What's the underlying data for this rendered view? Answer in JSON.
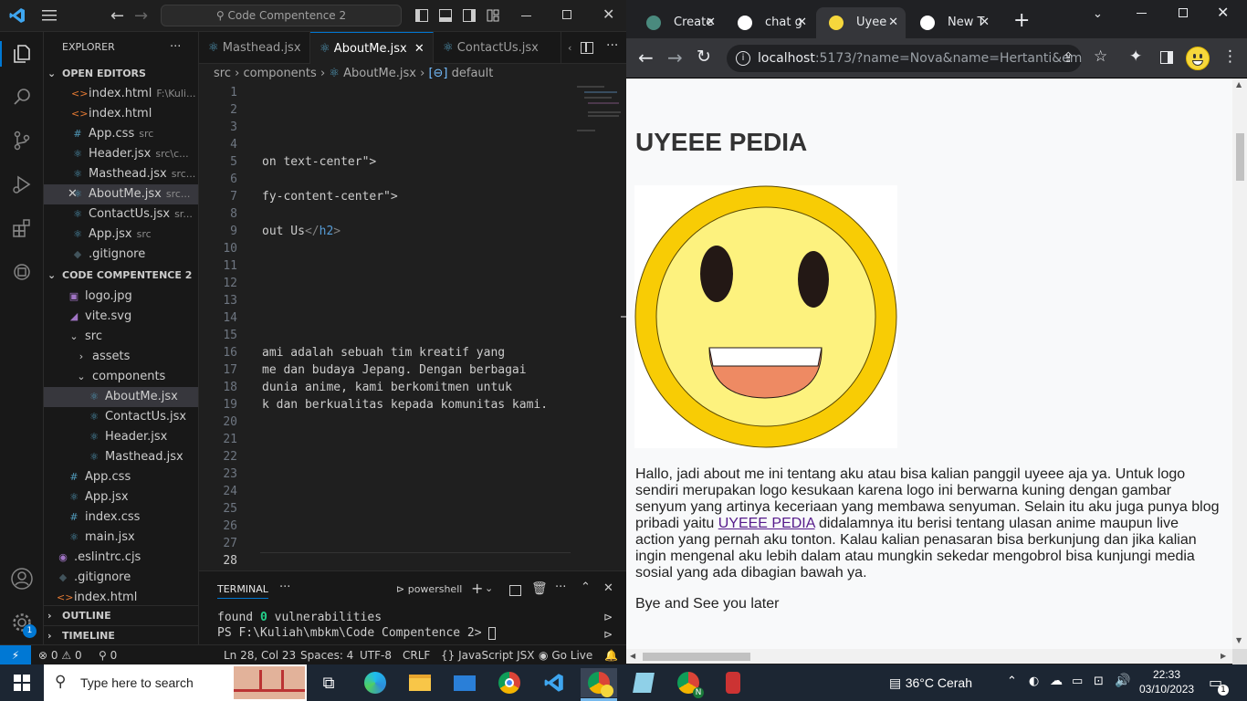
{
  "vscode": {
    "search": {
      "label": "Code Compentence 2"
    },
    "explorer": {
      "title": "EXPLORER",
      "more": "···"
    },
    "open_editors": {
      "title": "OPEN EDITORS",
      "items": [
        {
          "name": "index.html",
          "desc": "F:\\Kuli...",
          "icon": "<>",
          "color": "#e37933"
        },
        {
          "name": "index.html",
          "desc": "",
          "icon": "<>",
          "color": "#e37933"
        },
        {
          "name": "App.css",
          "desc": "src",
          "icon": "#",
          "color": "#519aba"
        },
        {
          "name": "Header.jsx",
          "desc": "src\\c...",
          "icon": "⚛",
          "color": "#519aba"
        },
        {
          "name": "Masthead.jsx",
          "desc": "src...",
          "icon": "⚛",
          "color": "#519aba"
        },
        {
          "name": "AboutMe.jsx",
          "desc": "src...",
          "icon": "⚛",
          "color": "#519aba"
        },
        {
          "name": "ContactUs.jsx",
          "desc": "sr...",
          "icon": "⚛",
          "color": "#519aba"
        },
        {
          "name": "App.jsx",
          "desc": "src",
          "icon": "⚛",
          "color": "#519aba"
        },
        {
          "name": ".gitignore",
          "desc": "",
          "icon": "◆",
          "color": "#41535b"
        }
      ]
    },
    "project": {
      "title": "CODE COMPENTENCE 2",
      "items": [
        {
          "name": "logo.jpg",
          "icon": "▣",
          "color": "#a074c4"
        },
        {
          "name": "vite.svg",
          "icon": "◢",
          "color": "#a074c4"
        },
        {
          "name": "src",
          "icon": "⌄",
          "color": "#ccc"
        },
        {
          "name": "assets",
          "icon": "›",
          "color": "#ccc"
        },
        {
          "name": "components",
          "icon": "⌄",
          "color": "#ccc"
        },
        {
          "name": "AboutMe.jsx",
          "icon": "⚛",
          "color": "#519aba"
        },
        {
          "name": "ContactUs.jsx",
          "icon": "⚛",
          "color": "#519aba"
        },
        {
          "name": "Header.jsx",
          "icon": "⚛",
          "color": "#519aba"
        },
        {
          "name": "Masthead.jsx",
          "icon": "⚛",
          "color": "#519aba"
        },
        {
          "name": "App.css",
          "icon": "#",
          "color": "#519aba"
        },
        {
          "name": "App.jsx",
          "icon": "⚛",
          "color": "#519aba"
        },
        {
          "name": "index.css",
          "icon": "#",
          "color": "#519aba"
        },
        {
          "name": "main.jsx",
          "icon": "⚛",
          "color": "#519aba"
        },
        {
          "name": ".eslintrc.cjs",
          "icon": "◉",
          "color": "#a074c4"
        },
        {
          "name": ".gitignore",
          "icon": "◆",
          "color": "#41535b"
        },
        {
          "name": "index.html",
          "icon": "<>",
          "color": "#e37933"
        }
      ]
    },
    "outline": "OUTLINE",
    "timeline": "TIMELINE",
    "tabs": [
      {
        "label": "Masthead.jsx",
        "active": false
      },
      {
        "label": "AboutMe.jsx",
        "active": true
      },
      {
        "label": "ContactUs.jsx",
        "active": false
      }
    ],
    "breadcrumb": {
      "a": "src",
      "b": "components",
      "c": "AboutMe.jsx",
      "d": "default"
    },
    "code_lines": [
      {
        "n": "1",
        "t": ""
      },
      {
        "n": "2",
        "t": ""
      },
      {
        "n": "3",
        "t": ""
      },
      {
        "n": "4",
        "t": ""
      },
      {
        "n": "5",
        "t": "on text-center\">"
      },
      {
        "n": "6",
        "t": ""
      },
      {
        "n": "7",
        "t": "fy-content-center\">"
      },
      {
        "n": "8",
        "t": ""
      },
      {
        "n": "9",
        "t": "out Us</h2>"
      },
      {
        "n": "10",
        "t": ""
      },
      {
        "n": "11",
        "t": ""
      },
      {
        "n": "12",
        "t": ""
      },
      {
        "n": "13",
        "t": ""
      },
      {
        "n": "14",
        "t": ""
      },
      {
        "n": "15",
        "t": ""
      },
      {
        "n": "16",
        "t": "ami adalah sebuah tim kreatif yang"
      },
      {
        "n": "17",
        "t": "me dan budaya Jepang. Dengan berbagai"
      },
      {
        "n": "18",
        "t": "dunia anime, kami berkomitmen untuk"
      },
      {
        "n": "19",
        "t": "k dan berkualitas kepada komunitas kami."
      },
      {
        "n": "20",
        "t": ""
      },
      {
        "n": "21",
        "t": ""
      },
      {
        "n": "22",
        "t": ""
      },
      {
        "n": "23",
        "t": ""
      },
      {
        "n": "24",
        "t": ""
      },
      {
        "n": "25",
        "t": ""
      },
      {
        "n": "26",
        "t": ""
      },
      {
        "n": "27",
        "t": ""
      },
      {
        "n": "28",
        "t": ""
      }
    ],
    "terminal": {
      "tab": "TERMINAL",
      "shell": "powershell",
      "line1_a": "found ",
      "line1_b": "0",
      "line1_c": " vulnerabilities",
      "line2": "PS F:\\Kuliah\\mbkm\\Code Compentence 2> "
    },
    "status": {
      "errors": "0",
      "warnings": "0",
      "ports": "0",
      "position": "Ln 28, Col 23",
      "spaces": "Spaces: 4",
      "encoding": "UTF-8",
      "eol": "CRLF",
      "language": "JavaScript JSX",
      "golive": "Go Live",
      "badge": "1"
    }
  },
  "browser": {
    "tabs": [
      {
        "label": "Create",
        "icon_color": "#4a8a7e"
      },
      {
        "label": "chat g",
        "icon_color": "#ffffff"
      },
      {
        "label": "Uyee",
        "icon_color": "#f6d73c"
      },
      {
        "label": "New T",
        "icon_color": "#ffffff"
      }
    ],
    "url_host": "localhost",
    "url_rest": ":5173/?name=Nova&name=Hertanti&em...",
    "page": {
      "heading": "UYEEE PEDIA",
      "para_before": "Hallo, jadi about me ini tentang aku atau bisa kalian panggil uyeee aja ya. Untuk logo sendiri merupakan logo kesukaan karena logo ini berwarna kuning dengan gambar senyum yang artinya keceriaan yang membawa senyuman. Selain itu aku juga punya blog pribadi yaitu ",
      "link": "UYEEE PEDIA",
      "para_after": " didalamnya itu berisi tentang ulasan anime maupun live action yang pernah aku tonton. Kalau kalian penasaran bisa berkunjung dan jika kalian ingin mengenal aku lebih dalam atau mungkin sekedar mengobrol bisa kunjungi media sosial yang ada dibagian bawah ya.",
      "bye": "Bye and See you later"
    }
  },
  "taskbar": {
    "search_placeholder": "Type here to search",
    "weather": "36°C  Cerah",
    "time": "22:33",
    "date": "03/10/2023"
  }
}
